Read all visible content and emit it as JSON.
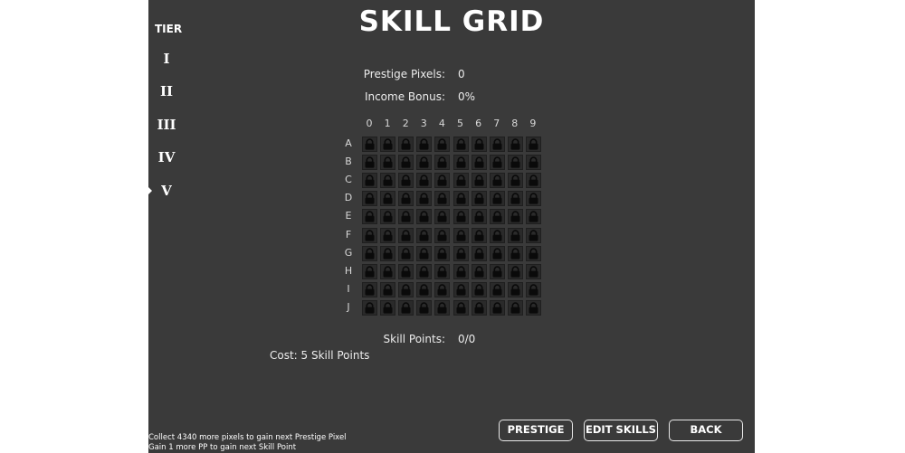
{
  "title": "SKILL GRID",
  "tiers": {
    "header": "TIER",
    "items": [
      "I",
      "II",
      "III",
      "IV",
      "V"
    ],
    "selected": "V"
  },
  "stats": {
    "prestige_pixels_label": "Prestige Pixels:",
    "prestige_pixels_value": "0",
    "income_bonus_label": "Income Bonus:",
    "income_bonus_value": "0%",
    "skill_points_label": "Skill Points:",
    "skill_points_value": "0/0"
  },
  "grid": {
    "columns": [
      "0",
      "1",
      "2",
      "3",
      "4",
      "5",
      "6",
      "7",
      "8",
      "9"
    ],
    "rows": [
      "A",
      "B",
      "C",
      "D",
      "E",
      "F",
      "G",
      "H",
      "I",
      "J"
    ],
    "cell_state": "locked",
    "cell_icon": "lock-icon"
  },
  "cost_text": "Cost: 5 Skill Points",
  "footer": {
    "line1": "Collect 4340 more pixels to gain next Prestige Pixel",
    "line2": "Gain 1 more PP to gain next Skill Point"
  },
  "buttons": {
    "prestige": "PRESTIGE",
    "edit_skills": "EDIT SKILLS",
    "back": "BACK"
  },
  "colors": {
    "panel_background": "#3a3a3a",
    "cell_background": "#2a2a2a",
    "lock_icon": "#0a0a0a",
    "text": "#ffffff"
  }
}
